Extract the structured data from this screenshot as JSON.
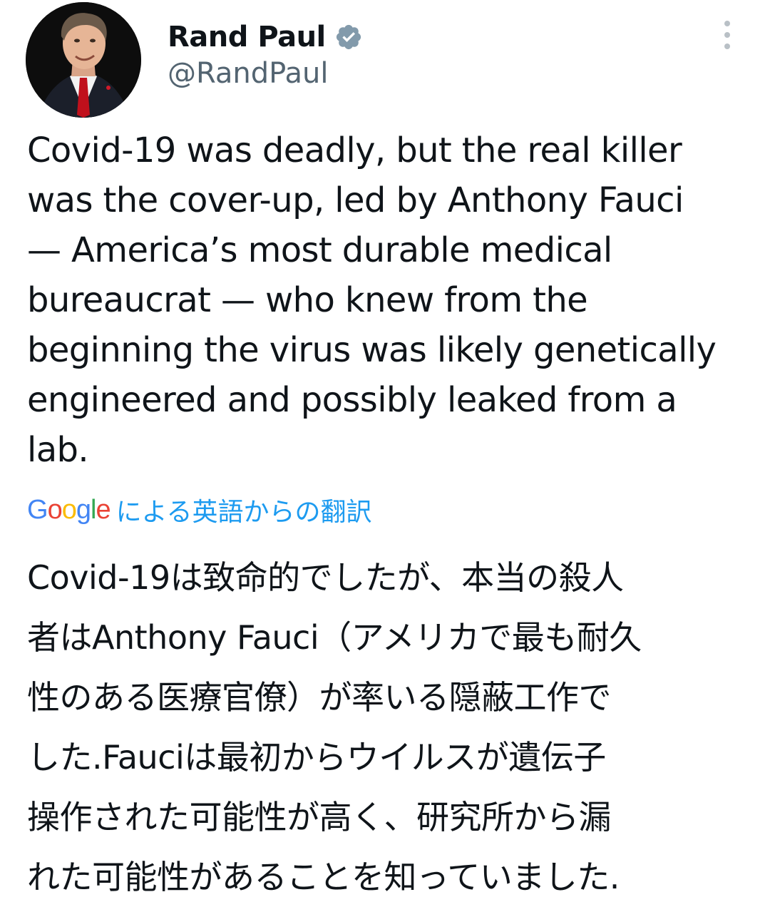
{
  "author": {
    "display_name": "Rand Paul",
    "handle": "@RandPaul",
    "verified": true,
    "avatar_icon": "profile-photo",
    "verified_icon": "verified-badge-icon",
    "verified_color": "#829aab"
  },
  "menu": {
    "icon": "more-vertical-icon"
  },
  "tweet": {
    "text": "Covid-19 was deadly, but the real killer\nwas the cover-up, led by Anthony Fauci\n— America’s most durable medical\nbureaucrat — who knew from the\nbeginning the virus was likely genetically\nengineered and possibly leaked from a\nlab."
  },
  "translation": {
    "provider_logo": {
      "letters": [
        "G",
        "o",
        "o",
        "g",
        "l",
        "e"
      ],
      "colors": [
        "#4285f4",
        "#ea4335",
        "#fbbc05",
        "#4285f4",
        "#34a853",
        "#ea4335"
      ]
    },
    "label": "による英語からの翻訳",
    "label_color": "#1d9bf0",
    "text": "Covid-19は致命的でしたが、本当の殺人\n者はAnthony Fauci（アメリカで最も耐久\n性のある医療官僚）が率いる隠蔽工作で\nした.Fauciは最初からウイルスが遺伝子\n操作された可能性が高く、研究所から漏\nれた可能性があることを知っていました."
  }
}
